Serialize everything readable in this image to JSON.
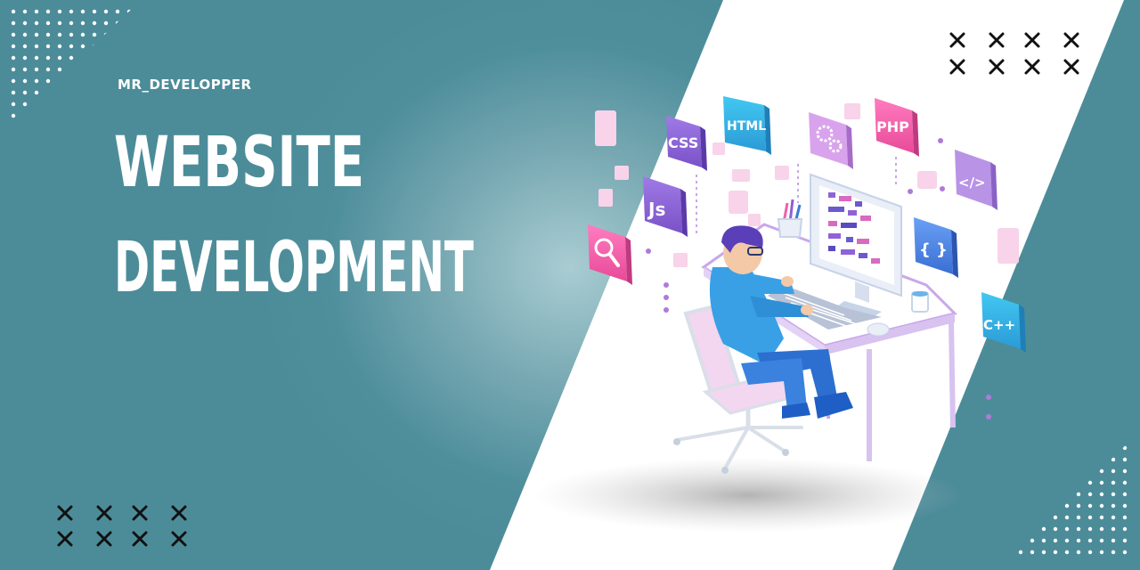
{
  "brand": {
    "name": "MR_DEVELOPPER"
  },
  "headline": {
    "line1": "WEBSITE",
    "line2": "DEVELOPMENT"
  },
  "illustration": {
    "tiles": [
      {
        "label": "CSS",
        "icon": "css-icon"
      },
      {
        "label": "HTML",
        "icon": "html-icon"
      },
      {
        "label": "",
        "icon": "gears-icon"
      },
      {
        "label": "PHP",
        "icon": "php-icon"
      },
      {
        "label": "</>",
        "icon": "code-tag-icon"
      },
      {
        "label": "Js",
        "icon": "javascript-icon"
      },
      {
        "label": "{ }",
        "icon": "curly-braces-icon"
      },
      {
        "label": "C++",
        "icon": "cpp-icon"
      },
      {
        "label": "",
        "icon": "magnifier-icon"
      }
    ]
  },
  "colors": {
    "background": "#4f8f9c",
    "panel": "#ffffff",
    "headline": "#ffffff",
    "accent_blue": "#3a7bd5",
    "accent_purple": "#8e5fd6",
    "accent_pink": "#f25fa8",
    "accent_cyan": "#35b8e8"
  }
}
